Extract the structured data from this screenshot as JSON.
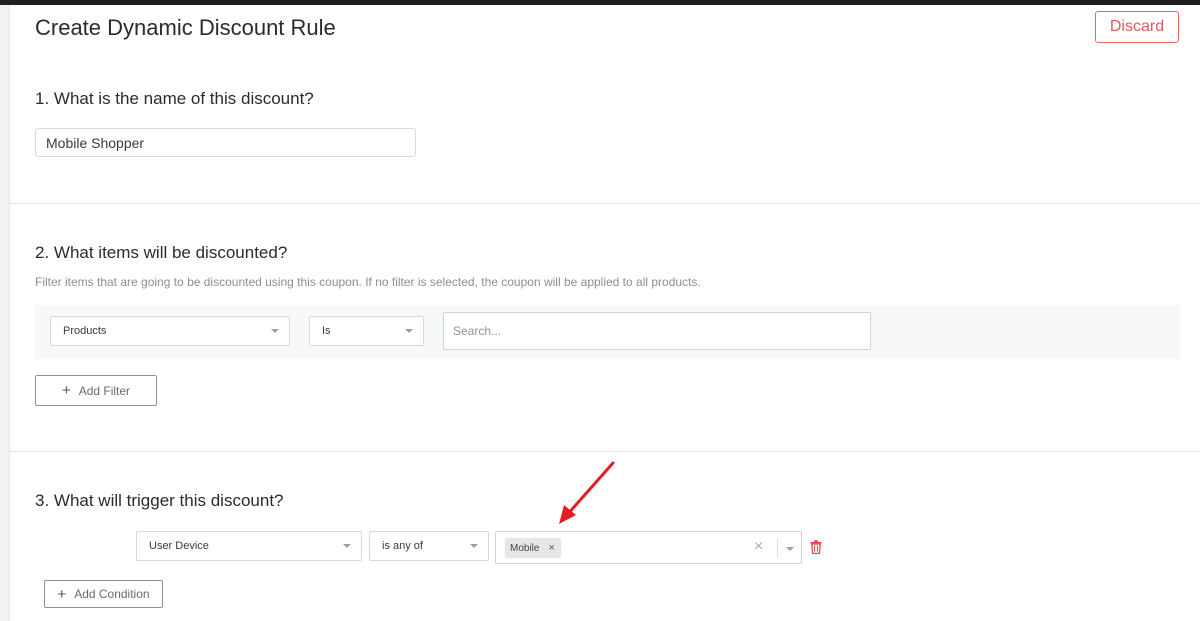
{
  "page": {
    "title": "Create Dynamic Discount Rule",
    "discard_label": "Discard"
  },
  "section1": {
    "question": "1. What is the name of this discount?",
    "name_value": "Mobile Shopper"
  },
  "section2": {
    "question": "2. What items will be discounted?",
    "help_text": "Filter items that are going to be discounted using this coupon. If no filter is selected, the coupon will be applied to all products.",
    "filter": {
      "field": "Products",
      "operator": "Is",
      "search_placeholder": "Search..."
    },
    "add_filter_label": "Add Filter"
  },
  "section3": {
    "question": "3. What will trigger this discount?",
    "condition": {
      "field": "User Device",
      "operator": "is any of",
      "selected_values": [
        "Mobile"
      ]
    },
    "add_condition_label": "Add Condition"
  },
  "icons": {
    "plus": "plus-icon",
    "remove_chip": "close-icon",
    "clear": "clear-icon",
    "dropdown": "chevron-down-icon",
    "delete": "trash-icon",
    "annotation": "red-arrow"
  },
  "colors": {
    "discard": "#e05a5a",
    "trash": "#e04848",
    "arrow": "#e02020"
  }
}
